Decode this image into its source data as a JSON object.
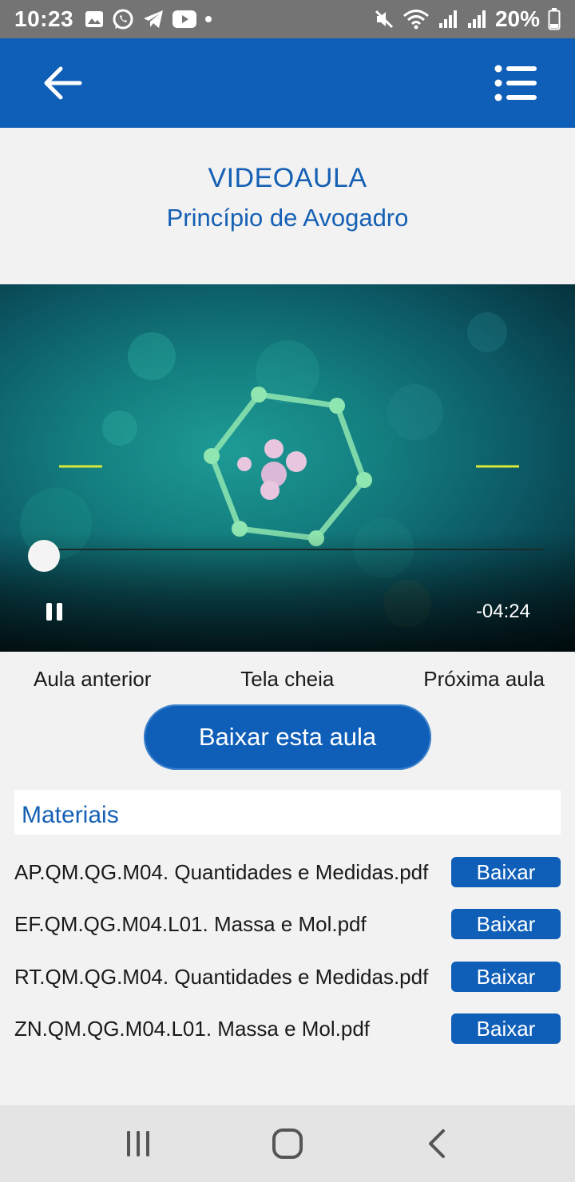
{
  "status_bar": {
    "time": "10:23",
    "battery": "20%",
    "notification_icons": [
      "gallery-icon",
      "whatsapp-icon",
      "telegram-icon",
      "youtube-icon",
      "dot-icon"
    ],
    "system_icons": [
      "mute-icon",
      "wifi-icon",
      "signal-icon",
      "signal-icon",
      "battery-icon"
    ]
  },
  "app_bar": {
    "back_icon": "arrow-left-icon",
    "menu_icon": "list-menu-icon",
    "color": "#0f5fb8"
  },
  "lesson": {
    "title": "VIDEOAULA",
    "subtitle": "Princípio de Avogadro"
  },
  "video": {
    "time_remaining": "-04:24",
    "progress_fraction": 0.0,
    "state": "playing"
  },
  "controls": {
    "previous": "Aula anterior",
    "fullscreen": "Tela cheia",
    "next": "Próxima aula"
  },
  "download_button": "Baixar esta aula",
  "materials": {
    "title": "Materiais",
    "items": [
      {
        "name": "AP.QM.QG.M04. Quantidades e Medidas.pdf",
        "action": "Baixar"
      },
      {
        "name": "EF.QM.QG.M04.L01. Massa e Mol.pdf",
        "action": "Baixar"
      },
      {
        "name": "RT.QM.QG.M04. Quantidades e Medidas.pdf",
        "action": "Baixar"
      },
      {
        "name": "ZN.QM.QG.M04.L01. Massa e Mol.pdf",
        "action": "Baixar"
      }
    ]
  },
  "nav_bar": {
    "icons": [
      "recent-apps-icon",
      "home-icon",
      "back-icon"
    ]
  }
}
